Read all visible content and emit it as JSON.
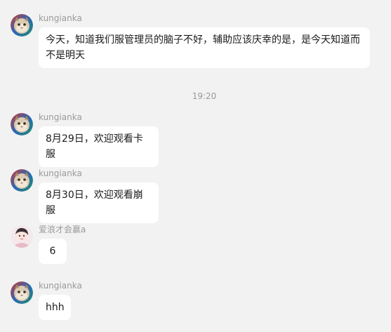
{
  "messages": [
    {
      "sender": "kungianka",
      "avatar_icon": "cat-avatar-icon",
      "text": "今天，知道我们服管理员的脑子不好，辅助应该庆幸的是，是今天知道而不是明天"
    },
    {
      "sender": "kungianka",
      "avatar_icon": "cat-avatar-icon",
      "text": "8月29日，欢迎观看卡服"
    },
    {
      "sender": "kungianka",
      "avatar_icon": "cat-avatar-icon",
      "text": "8月30日，欢迎观看崩服"
    },
    {
      "sender": "爱浪才会赢a",
      "avatar_icon": "anime-girl-avatar-icon",
      "text": "6"
    },
    {
      "sender": "kungianka",
      "avatar_icon": "cat-avatar-icon",
      "text": "hhh"
    }
  ],
  "timestamp": "19:20",
  "colors": {
    "background": "#f2f2f2",
    "bubble": "#ffffff",
    "sender_text": "#9a9a9a",
    "message_text": "#1a1a1a",
    "timestamp_text": "#999999"
  }
}
